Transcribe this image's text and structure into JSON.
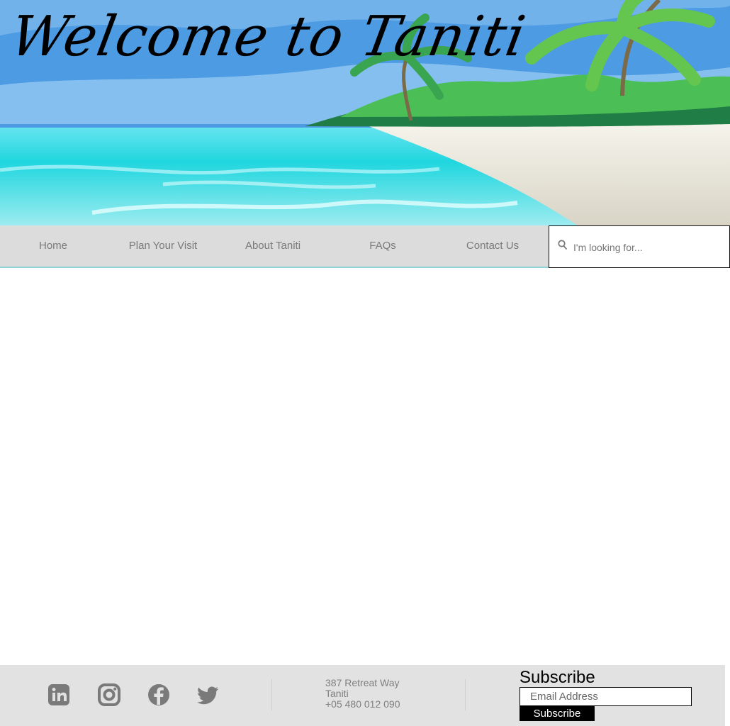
{
  "hero": {
    "title": "Welcome to Taniti"
  },
  "nav": {
    "items": [
      {
        "label": "Home"
      },
      {
        "label": "Plan Your Visit"
      },
      {
        "label": "About Taniti"
      },
      {
        "label": "FAQs"
      },
      {
        "label": "Contact Us"
      }
    ],
    "search": {
      "placeholder": "I'm looking for...",
      "icon": "search-icon"
    }
  },
  "footer": {
    "social_icons": [
      "linkedin-icon",
      "instagram-icon",
      "facebook-icon",
      "twitter-icon"
    ],
    "address": {
      "line1": "387 Retreat Way",
      "line2": "Taniti",
      "phone": "+05 480 012 090"
    },
    "subscribe": {
      "title": "Subscribe",
      "email_placeholder": "Email Address",
      "button_label": "Subscribe"
    }
  },
  "colors": {
    "nav_background": "#dcdcdc",
    "nav_text": "#7a7a7a",
    "footer_background": "#e2e2e2",
    "footer_text": "#7f7f7f",
    "social_icon": "#7a7a7a",
    "subscribe_button": "#000000"
  }
}
